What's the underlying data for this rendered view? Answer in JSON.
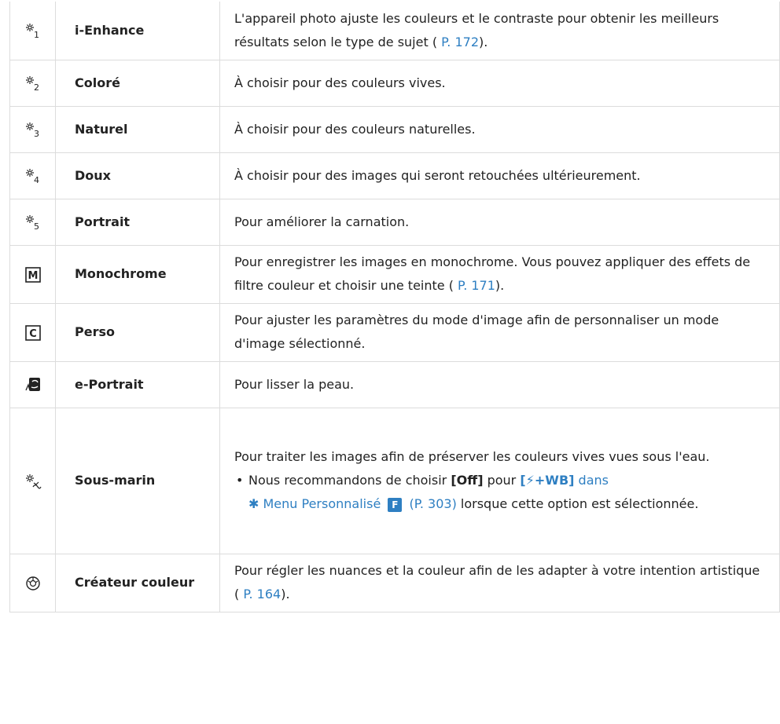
{
  "rows": [
    {
      "icon": "flower-1-icon",
      "name": "i-Enhance",
      "desc_pre": "L'appareil photo ajuste les couleurs et le contraste pour obtenir les meilleurs résultats selon le type de sujet (",
      "ref": " P. 172",
      "desc_post": ")."
    },
    {
      "icon": "flower-2-icon",
      "name": "Coloré",
      "desc": "À choisir pour des couleurs vives."
    },
    {
      "icon": "flower-3-icon",
      "name": "Naturel",
      "desc": "À choisir pour des couleurs naturelles."
    },
    {
      "icon": "flower-4-icon",
      "name": "Doux",
      "desc": "À choisir pour des images qui seront retouchées ultérieurement."
    },
    {
      "icon": "flower-5-icon",
      "name": "Portrait",
      "desc": "Pour améliorer la carnation."
    },
    {
      "icon": "monochrome-icon",
      "glyph": "M",
      "name": "Monochrome",
      "desc_pre": "Pour enregistrer les images en monochrome. Vous pouvez appliquer des effets de filtre couleur et choisir une teinte (",
      "ref": " P. 171",
      "desc_post": ")."
    },
    {
      "icon": "custom-icon",
      "glyph": "C",
      "name": "Perso",
      "desc": "Pour ajuster les paramètres du mode d'image afin de personnaliser un mode d'image sélectionné."
    },
    {
      "icon": "e-portrait-icon",
      "name": "e-Portrait",
      "desc": "Pour lisser la peau."
    },
    {
      "icon": "underwater-icon",
      "name": "Sous-marin",
      "desc": "Pour traiter les images afin de préserver les couleurs vives vues sous l'eau.",
      "bullet": {
        "pre": "Nous recommandons de choisir ",
        "off": "[Off]",
        "mid": " pour ",
        "wb": "[",
        "wb_flash": "⚡",
        "wb_rest": "+WB]",
        "dans": " dans",
        "menu": " Menu Personnalisé ",
        "menu_badge": "F",
        "ref": " (P. 303)",
        "post": " lorsque cette option est sélectionnée."
      }
    },
    {
      "icon": "color-creator-icon",
      "name": "Créateur couleur",
      "desc_pre": "Pour régler les nuances et la couleur afin de les adapter à votre intention artistique (",
      "ref": " P. 164",
      "desc_post": ")."
    }
  ],
  "colors": {
    "link": "#2e7fc2",
    "border": "#dcdcdc",
    "text": "#222222"
  }
}
